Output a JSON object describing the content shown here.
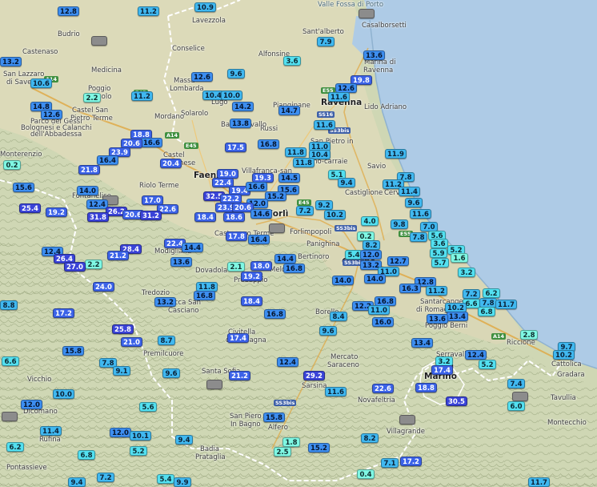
{
  "map": {
    "colors": {
      "sea": "#aecbe6",
      "land": "#cfd7b4",
      "plain": "#dad9b8",
      "border": "#ffffff"
    },
    "places": [
      {
        "id": "valle-fossa-di-porto",
        "name": "Valle Fossa di Porto",
        "cls": "water"
      },
      {
        "id": "san-alberto",
        "name": "Sant'alberto",
        "cls": ""
      },
      {
        "id": "casalborsetti",
        "name": "Casalborsetti",
        "cls": ""
      },
      {
        "id": "lavezzola",
        "name": "Lavezzola",
        "cls": ""
      },
      {
        "id": "budrio",
        "name": "Budrio",
        "cls": ""
      },
      {
        "id": "conselice",
        "name": "Conselice",
        "cls": ""
      },
      {
        "id": "castenaso",
        "name": "Castenaso",
        "cls": ""
      },
      {
        "id": "medicina",
        "name": "Medicina",
        "cls": ""
      },
      {
        "id": "san-lazzaro",
        "name": "San Lazzaro",
        "cls": ""
      },
      {
        "id": "di-savena",
        "name": "di Savena",
        "cls": ""
      },
      {
        "id": "alfonsine",
        "name": "Alfonsine",
        "cls": ""
      },
      {
        "id": "marina-di-ravenna",
        "name": "Marina di",
        "cls": ""
      },
      {
        "id": "marina-di-ravenna-2",
        "name": "Ravenna",
        "cls": ""
      },
      {
        "id": "massa-lombarda",
        "name": "Massa",
        "cls": ""
      },
      {
        "id": "massa-lombarda-2",
        "name": "Lombarda",
        "cls": ""
      },
      {
        "id": "poggio-piccolo",
        "name": "Poggio",
        "cls": ""
      },
      {
        "id": "poggio-piccolo-2",
        "name": "Piccolo",
        "cls": ""
      },
      {
        "id": "solarolo",
        "name": "Solarolo",
        "cls": ""
      },
      {
        "id": "lugo",
        "name": "Lugo",
        "cls": ""
      },
      {
        "id": "piangipane",
        "name": "Piangipane",
        "cls": ""
      },
      {
        "id": "ravenna",
        "name": "Ravenna",
        "cls": "big"
      },
      {
        "id": "lido-adriano",
        "name": "Lido Adriano",
        "cls": ""
      },
      {
        "id": "castel-san-pietro",
        "name": "Castel San",
        "cls": ""
      },
      {
        "id": "castel-san-pietro-2",
        "name": "Pietro Terme",
        "cls": ""
      },
      {
        "id": "parco-gessi",
        "name": "Parco dei Gessi",
        "cls": ""
      },
      {
        "id": "parco-gessi-2",
        "name": "Bolognesi e Calanchi",
        "cls": ""
      },
      {
        "id": "parco-gessi-3",
        "name": "dell'Abbadessa",
        "cls": ""
      },
      {
        "id": "mordano",
        "name": "Mordano",
        "cls": ""
      },
      {
        "id": "russi",
        "name": "Russi",
        "cls": ""
      },
      {
        "id": "bagnacavallo",
        "name": "Bagnacavallo",
        "cls": ""
      },
      {
        "id": "san-pietro-vincoli",
        "name": "San Pietro in",
        "cls": ""
      },
      {
        "id": "castel-bolognese",
        "name": "Castel",
        "cls": ""
      },
      {
        "id": "castel-bolognese-2",
        "name": "Bolognese",
        "cls": ""
      },
      {
        "id": "monterenzio",
        "name": "Monterenzio",
        "cls": ""
      },
      {
        "id": "savio",
        "name": "Savio",
        "cls": ""
      },
      {
        "id": "faenza",
        "name": "Faenza",
        "cls": "big"
      },
      {
        "id": "villafranca",
        "name": "Villafranca-san",
        "cls": ""
      },
      {
        "id": "san-stefano",
        "name": "Stefano-carraie",
        "cls": ""
      },
      {
        "id": "castiglione",
        "name": "Castiglione",
        "cls": ""
      },
      {
        "id": "riolo-terme",
        "name": "Riolo Terme",
        "cls": ""
      },
      {
        "id": "fontanelice",
        "name": "Fontanelice",
        "cls": ""
      },
      {
        "id": "cervia",
        "name": "Cervia",
        "cls": ""
      },
      {
        "id": "forli",
        "name": "Forlì",
        "cls": "big"
      },
      {
        "id": "castrocaro",
        "name": "Castrocaro Terme",
        "cls": ""
      },
      {
        "id": "forlimpopoli",
        "name": "Forlimpopoli",
        "cls": ""
      },
      {
        "id": "panighina",
        "name": "Panighina",
        "cls": ""
      },
      {
        "id": "modigliana",
        "name": "Modigliana",
        "cls": ""
      },
      {
        "id": "bertinoro",
        "name": "Bertinoro",
        "cls": ""
      },
      {
        "id": "cesena",
        "name": "Cesena",
        "cls": "big"
      },
      {
        "id": "dovadola",
        "name": "Dovadola",
        "cls": ""
      },
      {
        "id": "meldola",
        "name": "Meldola",
        "cls": ""
      },
      {
        "id": "predappio",
        "name": "Predappio",
        "cls": ""
      },
      {
        "id": "tredozio",
        "name": "Tredozio",
        "cls": ""
      },
      {
        "id": "rocca-san-casciano",
        "name": "Rocca San",
        "cls": ""
      },
      {
        "id": "rocca-san-casciano-2",
        "name": "Casciano",
        "cls": ""
      },
      {
        "id": "santarcangelo",
        "name": "Santarcangelo",
        "cls": ""
      },
      {
        "id": "santarcangelo-2",
        "name": "di Romagna",
        "cls": ""
      },
      {
        "id": "borello",
        "name": "Borello",
        "cls": ""
      },
      {
        "id": "poggio-berni",
        "name": "Poggio Berni",
        "cls": ""
      },
      {
        "id": "premilcuore",
        "name": "Premilcuore",
        "cls": ""
      },
      {
        "id": "civitella",
        "name": "Civitella",
        "cls": ""
      },
      {
        "id": "civitella-2",
        "name": "di Romagna",
        "cls": ""
      },
      {
        "id": "riccione",
        "name": "Riccione",
        "cls": ""
      },
      {
        "id": "serravalle",
        "name": "Serravalle",
        "cls": ""
      },
      {
        "id": "mercato-saraceno",
        "name": "Mercato",
        "cls": ""
      },
      {
        "id": "mercato-saraceno-2",
        "name": "Saraceno",
        "cls": ""
      },
      {
        "id": "san-marino",
        "name": "San",
        "cls": "big"
      },
      {
        "id": "san-marino-2",
        "name": "Marino",
        "cls": "big"
      },
      {
        "id": "cattolica",
        "name": "Cattolica",
        "cls": ""
      },
      {
        "id": "gradara",
        "name": "Gradara",
        "cls": ""
      },
      {
        "id": "vicchio",
        "name": "Vicchio",
        "cls": ""
      },
      {
        "id": "santa-sofia",
        "name": "Santa Sofia",
        "cls": ""
      },
      {
        "id": "sarsina",
        "name": "Sarsina",
        "cls": ""
      },
      {
        "id": "novafeltria",
        "name": "Novafeltria",
        "cls": ""
      },
      {
        "id": "tavullia",
        "name": "Tavullia",
        "cls": ""
      },
      {
        "id": "dicomano",
        "name": "Dicomano",
        "cls": ""
      },
      {
        "id": "san-piero-bagno",
        "name": "San Piero",
        "cls": ""
      },
      {
        "id": "san-piero-bagno-2",
        "name": "In Bagno",
        "cls": ""
      },
      {
        "id": "alfero",
        "name": "Alfero",
        "cls": ""
      },
      {
        "id": "montecchio",
        "name": "Montecchio",
        "cls": ""
      },
      {
        "id": "rufina",
        "name": "Rufina",
        "cls": ""
      },
      {
        "id": "villagrande",
        "name": "Villagrande",
        "cls": ""
      },
      {
        "id": "badia-prataglia",
        "name": "Badia",
        "cls": ""
      },
      {
        "id": "badia-prataglia-2",
        "name": "Prataglia",
        "cls": ""
      },
      {
        "id": "pontassieve",
        "name": "Pontassieve",
        "cls": ""
      }
    ],
    "roads": [
      {
        "id": "a14-north",
        "label": "A14",
        "cls": "g"
      },
      {
        "id": "e45-north",
        "label": "E45",
        "cls": "g"
      },
      {
        "id": "e55-ravenna",
        "label": "E55",
        "cls": "g"
      },
      {
        "id": "ss16",
        "label": "SS16",
        "cls": "b"
      },
      {
        "id": "a14-castel",
        "label": "A14",
        "cls": "g"
      },
      {
        "id": "e45-castel",
        "label": "E45",
        "cls": "g"
      },
      {
        "id": "ss3bis-ravenna",
        "label": "SS3bis",
        "cls": "b"
      },
      {
        "id": "e45-forli",
        "label": "E45",
        "cls": "g"
      },
      {
        "id": "ss3bis-forli",
        "label": "SS3bis",
        "cls": "b"
      },
      {
        "id": "e55-cervia",
        "label": "E55",
        "cls": "g"
      },
      {
        "id": "a14-rimini",
        "label": "A14",
        "cls": "g"
      },
      {
        "id": "ss3bis-cesena",
        "label": "SS3bis",
        "cls": "b"
      },
      {
        "id": "ss3bis-sarsina",
        "label": "SS3bis",
        "cls": "b"
      }
    ],
    "stations": [
      {
        "v": "12.8"
      },
      {
        "v": "11.2"
      },
      {
        "v": "10.9"
      },
      {
        "v": ""
      },
      {
        "v": "7.9"
      },
      {
        "v": ""
      },
      {
        "v": "3.6"
      },
      {
        "v": "13.6"
      },
      {
        "v": "13.2"
      },
      {
        "v": "10.6"
      },
      {
        "v": "12.6"
      },
      {
        "v": "9.6"
      },
      {
        "v": "19.8"
      },
      {
        "v": "12.6"
      },
      {
        "v": "2.2"
      },
      {
        "v": "11.2"
      },
      {
        "v": "10.4"
      },
      {
        "v": "10.0"
      },
      {
        "v": "11.6"
      },
      {
        "v": "14.8"
      },
      {
        "v": "12.6"
      },
      {
        "v": "14.2"
      },
      {
        "v": "14.7"
      },
      {
        "v": "13.8"
      },
      {
        "v": "11.6"
      },
      {
        "v": "18.8"
      },
      {
        "v": "16.6"
      },
      {
        "v": "20.6"
      },
      {
        "v": "17.5"
      },
      {
        "v": "16.8"
      },
      {
        "v": "11.0"
      },
      {
        "v": "11.8"
      },
      {
        "v": "10.4"
      },
      {
        "v": "23.9"
      },
      {
        "v": "11.9"
      },
      {
        "v": "16.4"
      },
      {
        "v": "20.4"
      },
      {
        "v": "11.8"
      },
      {
        "v": "0.2"
      },
      {
        "v": "21.8"
      },
      {
        "v": "19.0"
      },
      {
        "v": "19.3"
      },
      {
        "v": "14.5"
      },
      {
        "v": "5.1"
      },
      {
        "v": "7.8"
      },
      {
        "v": "22.4"
      },
      {
        "v": "9.4"
      },
      {
        "v": "11.2"
      },
      {
        "v": "15.6"
      },
      {
        "v": "14.0"
      },
      {
        "v": "19.4"
      },
      {
        "v": "16.6"
      },
      {
        "v": "15.6"
      },
      {
        "v": "11.4"
      },
      {
        "v": ""
      },
      {
        "v": "32.5"
      },
      {
        "v": "22.2"
      },
      {
        "v": "15.2"
      },
      {
        "v": "9.6"
      },
      {
        "v": "12.4"
      },
      {
        "v": "17.0"
      },
      {
        "v": "22.6"
      },
      {
        "v": "12.0"
      },
      {
        "v": "9.2"
      },
      {
        "v": "25.4"
      },
      {
        "v": "19.2"
      },
      {
        "v": "26.2"
      },
      {
        "v": "23.9"
      },
      {
        "v": "20.6"
      },
      {
        "v": "7.2"
      },
      {
        "v": "10.2"
      },
      {
        "v": "11.6"
      },
      {
        "v": "31.8"
      },
      {
        "v": "20.6"
      },
      {
        "v": "31.2"
      },
      {
        "v": "18.4"
      },
      {
        "v": "18.6"
      },
      {
        "v": "14.6"
      },
      {
        "v": "4.0"
      },
      {
        "v": "9.8"
      },
      {
        "v": "7.0"
      },
      {
        "v": ""
      },
      {
        "v": "17.8"
      },
      {
        "v": "16.4"
      },
      {
        "v": "0.2"
      },
      {
        "v": "7.8"
      },
      {
        "v": "5.6"
      },
      {
        "v": "22.4"
      },
      {
        "v": "14.4"
      },
      {
        "v": "8.2"
      },
      {
        "v": "3.6"
      },
      {
        "v": "12.4"
      },
      {
        "v": "28.4"
      },
      {
        "v": "5.9"
      },
      {
        "v": "5.2"
      },
      {
        "v": "26.4"
      },
      {
        "v": "21.2"
      },
      {
        "v": "5.4"
      },
      {
        "v": "12.0"
      },
      {
        "v": "1.6"
      },
      {
        "v": "2.2"
      },
      {
        "v": "27.0"
      },
      {
        "v": "13.6"
      },
      {
        "v": "14.4"
      },
      {
        "v": "12.7"
      },
      {
        "v": "5.7"
      },
      {
        "v": "13.2"
      },
      {
        "v": "2.1"
      },
      {
        "v": "18.0"
      },
      {
        "v": "16.8"
      },
      {
        "v": "11.0"
      },
      {
        "v": "3.2"
      },
      {
        "v": "19.2"
      },
      {
        "v": "14.0"
      },
      {
        "v": "14.0"
      },
      {
        "v": "12.8"
      },
      {
        "v": "24.0"
      },
      {
        "v": "11.8"
      },
      {
        "v": "16.3"
      },
      {
        "v": "11.2"
      },
      {
        "v": "16.8"
      },
      {
        "v": "7.2"
      },
      {
        "v": "6.2"
      },
      {
        "v": "8.8"
      },
      {
        "v": "13.2"
      },
      {
        "v": "18.4"
      },
      {
        "v": "16.8"
      },
      {
        "v": "6.6"
      },
      {
        "v": "7.8"
      },
      {
        "v": "11.7"
      },
      {
        "v": "12.2"
      },
      {
        "v": "11.0"
      },
      {
        "v": "10.2"
      },
      {
        "v": "17.2"
      },
      {
        "v": "16.8"
      },
      {
        "v": "8.4"
      },
      {
        "v": "6.8"
      },
      {
        "v": "13.4"
      },
      {
        "v": "13.6"
      },
      {
        "v": "16.0"
      },
      {
        "v": "25.8"
      },
      {
        "v": "9.6"
      },
      {
        "v": "21.0"
      },
      {
        "v": "8.7"
      },
      {
        "v": "17.4"
      },
      {
        "v": "2.8"
      },
      {
        "v": "13.4"
      },
      {
        "v": "15.8"
      },
      {
        "v": "9.7"
      },
      {
        "v": "12.4"
      },
      {
        "v": "6.6"
      },
      {
        "v": "7.8"
      },
      {
        "v": "3.2"
      },
      {
        "v": "10.2"
      },
      {
        "v": "12.4"
      },
      {
        "v": "9.1"
      },
      {
        "v": "17.4"
      },
      {
        "v": "5.2"
      },
      {
        "v": "9.6"
      },
      {
        "v": "21.2"
      },
      {
        "v": "29.2"
      },
      {
        "v": ""
      },
      {
        "v": "7.4"
      },
      {
        "v": "18.8"
      },
      {
        "v": "22.6"
      },
      {
        "v": "10.0"
      },
      {
        "v": "11.6"
      },
      {
        "v": ""
      },
      {
        "v": "12.0"
      },
      {
        "v": "30.5"
      },
      {
        "v": "5.6"
      },
      {
        "v": "6.0"
      },
      {
        "v": ""
      },
      {
        "v": "15.8"
      },
      {
        "v": ""
      },
      {
        "v": "11.4"
      },
      {
        "v": "12.0"
      },
      {
        "v": "10.1"
      },
      {
        "v": "9.4"
      },
      {
        "v": "8.2"
      },
      {
        "v": "6.2"
      },
      {
        "v": "1.8"
      },
      {
        "v": "5.2"
      },
      {
        "v": "2.5"
      },
      {
        "v": "15.2"
      },
      {
        "v": "6.8"
      },
      {
        "v": "0.4"
      },
      {
        "v": "7.1"
      },
      {
        "v": "17.2"
      },
      {
        "v": "9.4"
      },
      {
        "v": "7.2"
      },
      {
        "v": "5.4"
      },
      {
        "v": "9.9"
      },
      {
        "v": "11.7"
      }
    ]
  }
}
